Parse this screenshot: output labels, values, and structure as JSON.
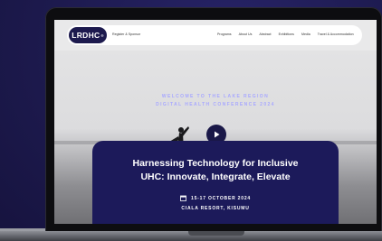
{
  "site": {
    "logo": "LRDHC",
    "logo_mark": "®",
    "nav_sub": "Register & Sponsor",
    "nav_links": [
      "Programs",
      "About Us",
      "Abstract",
      "Exhibitions",
      "Media",
      "Travel & Accommodation"
    ]
  },
  "hero": {
    "welcome_line1": "WELCOME TO THE LAKE REGION",
    "welcome_line2": "DIGITAL HEALTH CONFERENCE 2024",
    "play_icon": "play-icon"
  },
  "card": {
    "title_line1": "Harnessing Technology for Inclusive",
    "title_line2": "UHC: Innovate, Integrate, Elevate",
    "date": "15-17 OCTOBER 2024",
    "venue": "CIALA RESORT, KISUMU",
    "calendar_icon": "calendar-icon"
  },
  "colors": {
    "background": "#1d1a4e",
    "brand_navy": "#1c1a5a",
    "accent_lavender": "#a8a8ff"
  }
}
